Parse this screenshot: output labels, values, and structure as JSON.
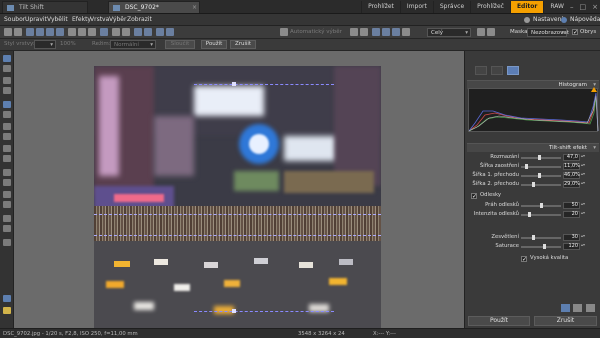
{
  "tabs": [
    {
      "label": "Tilt Shift",
      "active": false
    },
    {
      "label": "DSC_9702*",
      "active": true
    }
  ],
  "modes": [
    "Prohlížet",
    "Import",
    "Správce",
    "Prohlížeč",
    "Editor",
    "RAW"
  ],
  "active_mode": "Editor",
  "menu": [
    "Soubor",
    "Upravit",
    "Vyb|ěrat",
    "Efekty",
    "Vrstva",
    "Výběr",
    "Zobrazit"
  ],
  "menu_fixed": [
    "Soubor",
    "Upravit",
    "Vybělit",
    "Efekty",
    "Vrstva",
    "Výběr",
    "Zobrazit"
  ],
  "menu_right": {
    "settings": "Nastavení",
    "help": "Nápověda"
  },
  "toolbar1": {
    "auto_label": "Automatický výběr",
    "zoom_value": "Celý",
    "mask_label": "Maska:",
    "mask_value": "Nezobrazovat",
    "outline_label": "Obrys"
  },
  "toolbar2": {
    "brush_style_label": "Styl vrstvy:",
    "opacity_value": "100%",
    "blend_label": "Režim:",
    "blend_value": "Normální",
    "flatten_label": "Sloučit",
    "apply_button": "Použít",
    "cancel_button": "Zrušit"
  },
  "panel": {
    "histogram_title": "Histogram",
    "effect_title": "Tilt-shift efekt",
    "sliders": [
      {
        "label": "Rozmazání",
        "value": "47,0",
        "frac": 0.47
      },
      {
        "label": "Šířka zaostření",
        "value": "11,0%",
        "frac": 0.11
      },
      {
        "label": "Šířka 1. přechodu",
        "value": "46,0%",
        "frac": 0.46
      },
      {
        "label": "Šířka 2. přechodu",
        "value": "29,0%",
        "frac": 0.29
      }
    ],
    "reflections_label": "Odlesky",
    "reflection_sliders": [
      {
        "label": "Práh odlesků",
        "value": "50",
        "frac": 0.5
      },
      {
        "label": "Intenzita odlesků",
        "value": "20",
        "frac": 0.2
      }
    ],
    "color_sliders": [
      {
        "label": "Zesvětlení",
        "value": "30",
        "frac": 0.3
      },
      {
        "label": "Saturace",
        "value": "120",
        "frac": 0.6
      }
    ],
    "high_quality_label": "Vysoká kvalita",
    "apply_button": "Použít",
    "cancel_button": "Zrušit"
  },
  "status": {
    "file": "DSC_9702.jpg - 1/20 s, F2,8, ISO 250, f=11,00 mm",
    "dimensions": "3548 x 3264 x 24",
    "coords": "X:---  Y:---"
  },
  "colors": {
    "editor_accent": "#f5a000",
    "active_tab_blue": "#5c7eb6"
  }
}
